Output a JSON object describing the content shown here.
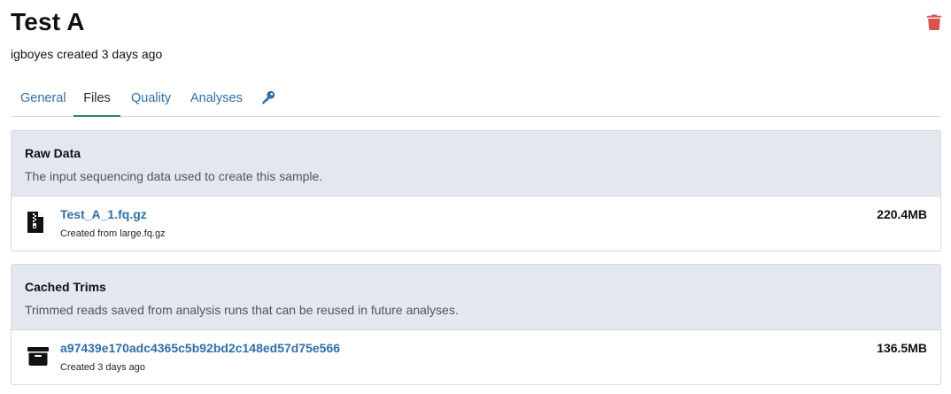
{
  "header": {
    "title": "Test A",
    "subtitle": "igboyes created 3 days ago"
  },
  "tabs": [
    {
      "label": "General"
    },
    {
      "label": "Files"
    },
    {
      "label": "Quality"
    },
    {
      "label": "Analyses"
    }
  ],
  "colors": {
    "link": "#2f6fa8",
    "panel_header_bg": "#e3e8f0",
    "delete": "#d9534f",
    "active_tab_underline": "#2f7e7a"
  },
  "icons": {
    "delete": "trash-icon",
    "permissions_tab": "key-icon",
    "raw_file": "file-archive-icon",
    "cached_trim": "archive-box-icon"
  },
  "raw_data": {
    "title": "Raw Data",
    "description": "The input sequencing data used to create this sample.",
    "files": [
      {
        "name": "Test_A_1.fq.gz",
        "meta": "Created from large.fq.gz",
        "size": "220.4MB"
      }
    ]
  },
  "cached_trims": {
    "title": "Cached Trims",
    "description": "Trimmed reads saved from analysis runs that can be reused in future analyses.",
    "files": [
      {
        "name": "a97439e170adc4365c5b92bd2c148ed57d75e566",
        "meta": "Created 3 days ago",
        "size": "136.5MB"
      }
    ]
  }
}
